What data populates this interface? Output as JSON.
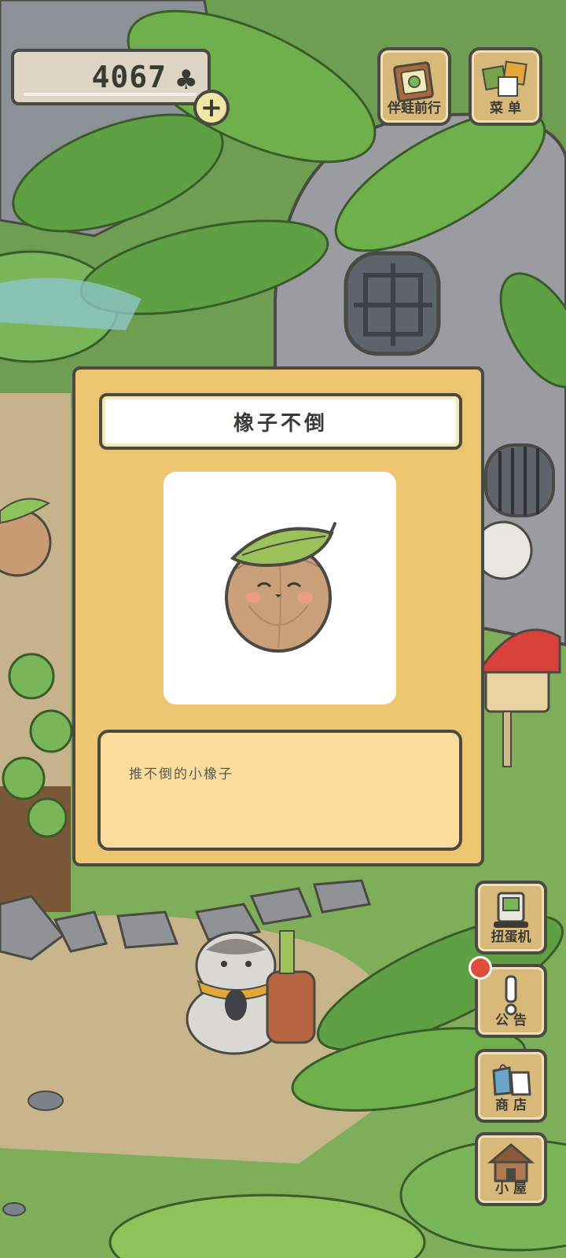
{
  "currency": {
    "amount": "4067",
    "symbol": "♣",
    "add_label": "+"
  },
  "top_buttons": [
    {
      "label": "伴蛙前行",
      "icon": "album-icon"
    },
    {
      "label": "菜 单",
      "icon": "menu-cards-icon"
    }
  ],
  "dialog": {
    "title": "橡子不倒",
    "image_icon": "acorn-tumbler-icon",
    "description": "推不倒的小橡子"
  },
  "side_buttons": [
    {
      "label": "扭蛋机",
      "icon": "gacha-machine-icon",
      "badge": false
    },
    {
      "label": "公 告",
      "icon": "exclamation-icon",
      "badge": true
    },
    {
      "label": "商 店",
      "icon": "shop-bags-icon",
      "badge": false
    },
    {
      "label": "小 屋",
      "icon": "house-icon",
      "badge": false
    }
  ],
  "colors": {
    "panel": "#edc470",
    "outline": "#4a4a42",
    "grass": "#8eb45d",
    "leaf": "#5ea043",
    "badge": "#e14d3d"
  }
}
